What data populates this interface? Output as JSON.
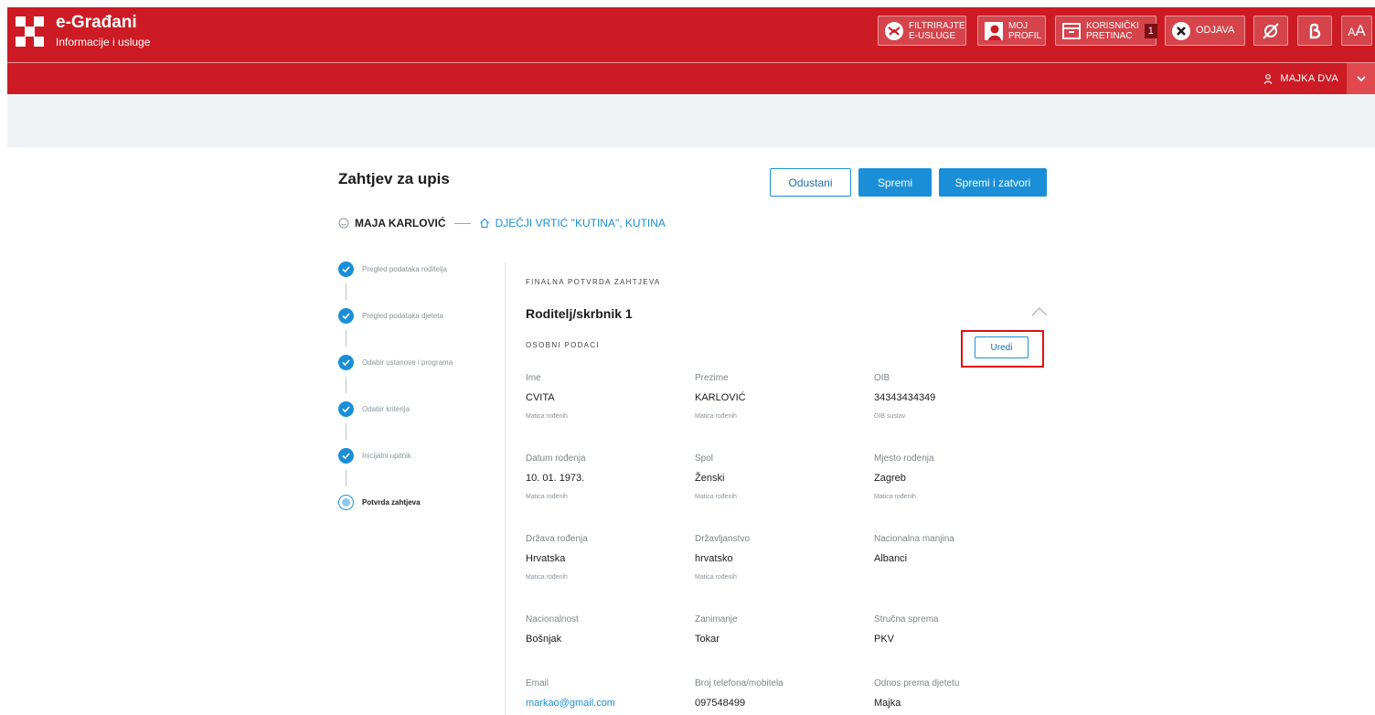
{
  "brand": {
    "title": "e-Građani",
    "subtitle": "Informacije i usluge",
    "accent": "#cc1b24"
  },
  "topbar": {
    "filter_label_1": "FILTRIRAJTE",
    "filter_label_2": "E-USLUGE",
    "profile_label_1": "MOJ",
    "profile_label_2": "PROFIL",
    "inbox_label_1": "KORISNIČKI",
    "inbox_label_2": "PRETINAC",
    "inbox_count": "1",
    "logout_label": "ODJAVA",
    "font_size_label": "AA"
  },
  "user": {
    "name": "MAJKA DVA"
  },
  "page": {
    "title": "Zahtjev za upis",
    "cancel_label": "Odustani",
    "save_label": "Spremi",
    "save_close_label": "Spremi i zatvori",
    "child_name": "MAJA KARLOVIĆ",
    "institution": "DJEČJI VRTIĆ \"KUTINA\", KUTINA"
  },
  "steps": [
    {
      "label": "Pregled podataka roditelja",
      "status": "done"
    },
    {
      "label": "Pregled podataka djeteta",
      "status": "done"
    },
    {
      "label": "Odabir ustanove i programa",
      "status": "done"
    },
    {
      "label": "Odabir kriterija",
      "status": "done"
    },
    {
      "label": "Inicijalni upitnik",
      "status": "done"
    },
    {
      "label": "Potvrda zahtjeva",
      "status": "current"
    }
  ],
  "section": {
    "eyebrow": "FINALNA POTVRDA ZAHTJEVA",
    "card_title": "Roditelj/skrbnik 1",
    "sub_eyebrow": "OSOBNI PODACI",
    "edit_label": "Uredi"
  },
  "fields": [
    {
      "label": "Ime",
      "value": "CVITA",
      "source": "Matica rođenih"
    },
    {
      "label": "Prezime",
      "value": "KARLOVIĆ",
      "source": "Matica rođenih"
    },
    {
      "label": "OIB",
      "value": "34343434349",
      "source": "OIB sustav"
    },
    {
      "label": "Datum rođenja",
      "value": "10. 01. 1973.",
      "source": "Matica rođenih"
    },
    {
      "label": "Spol",
      "value": "Ženski",
      "source": "Matica rođenih"
    },
    {
      "label": "Mjesto rođenja",
      "value": "Zagreb",
      "source": "Matica rođenih"
    },
    {
      "label": "Država rođenja",
      "value": "Hrvatska",
      "source": "Matica rođenih"
    },
    {
      "label": "Državljanstvo",
      "value": "hrvatsko",
      "source": "Matica rođenih"
    },
    {
      "label": "Nacionalna manjina",
      "value": "Albanci",
      "source": ""
    },
    {
      "label": "Nacionalnost",
      "value": "Bošnjak",
      "source": ""
    },
    {
      "label": "Zanimanje",
      "value": "Tokar",
      "source": ""
    },
    {
      "label": "Stručna sprema",
      "value": "PKV",
      "source": ""
    },
    {
      "label": "Email",
      "value": "markao@gmail.com",
      "source": ""
    },
    {
      "label": "Broj telefona/mobitela",
      "value": "097548499",
      "source": ""
    },
    {
      "label": "Odnos prema djetetu",
      "value": "Majka",
      "source": ""
    }
  ]
}
